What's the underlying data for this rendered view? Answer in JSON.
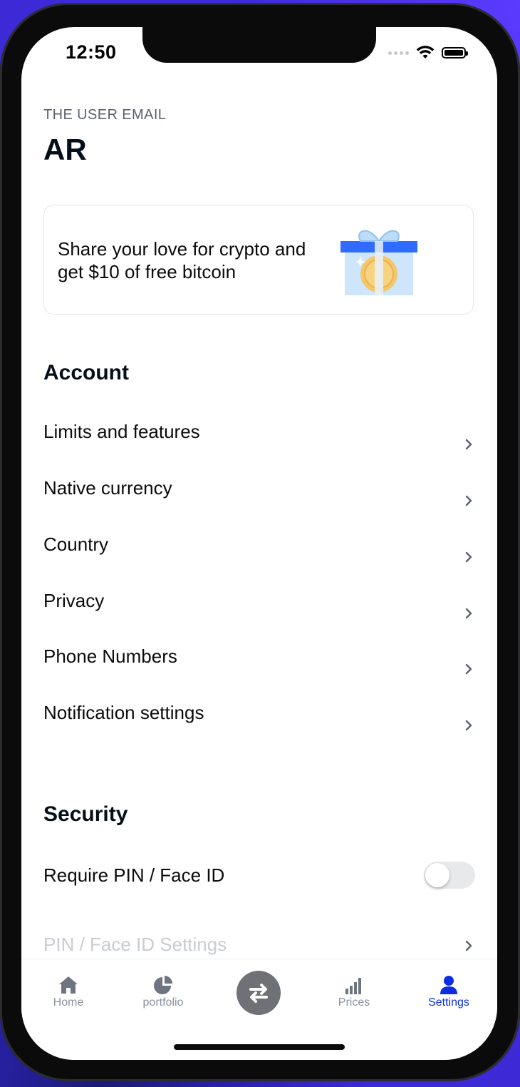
{
  "status_bar": {
    "time": "12:50"
  },
  "profile": {
    "email_label": "THE USER EMAIL",
    "name": "AR"
  },
  "promo": {
    "text": "Share your love for crypto and get $10 of free bitcoin",
    "icon": "gift-coin-icon"
  },
  "account": {
    "title": "Account",
    "items": [
      {
        "label": "Limits and features"
      },
      {
        "label": "Native currency"
      },
      {
        "label": "Country"
      },
      {
        "label": "Privacy"
      },
      {
        "label": "Phone Numbers"
      },
      {
        "label": "Notification settings"
      }
    ]
  },
  "security": {
    "title": "Security",
    "require_pin_label": "Require PIN / Face ID",
    "require_pin_enabled": false,
    "pin_settings_label": "PIN / Face ID Settings"
  },
  "tabbar": {
    "tabs": [
      {
        "label": "Home",
        "icon": "home-icon",
        "active": false
      },
      {
        "label": "portfolio",
        "icon": "pie-chart-icon",
        "active": false
      },
      {
        "label": "Prices",
        "icon": "bar-chart-icon",
        "active": false
      },
      {
        "label": "Settings",
        "icon": "person-icon",
        "active": true
      }
    ],
    "center_action_icon": "swap-arrows-icon"
  },
  "colors": {
    "accent": "#0b2fe0",
    "text_primary": "#0a0b0d",
    "text_secondary": "#5b616e",
    "inactive_tab": "#8a919e"
  }
}
